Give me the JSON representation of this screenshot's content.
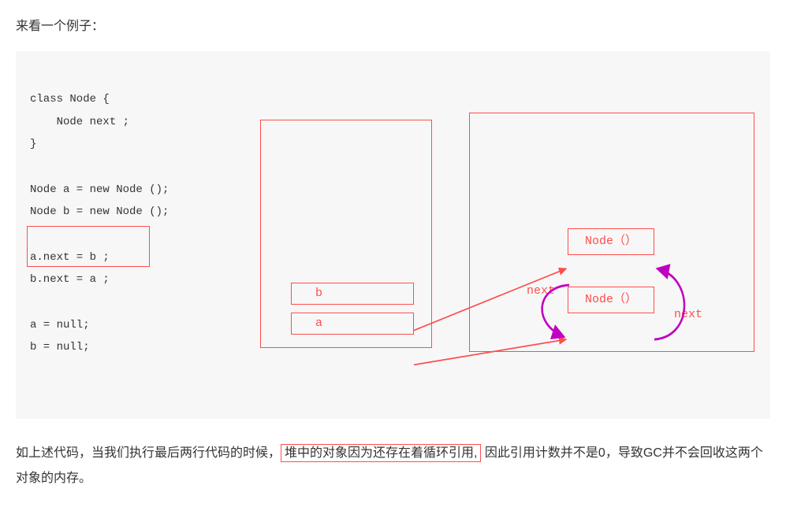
{
  "intro": "来看一个例子：",
  "code": {
    "l1": "class Node {",
    "l2": "    Node next ;",
    "l3": "}",
    "l4": "",
    "l5": "Node a = new Node ();",
    "l6": "Node b = new Node ();",
    "l7": "",
    "l8": "a.next = b ;",
    "l9": "b.next = a ;",
    "l10": "",
    "l11": "a = null;",
    "l12": "b = null;"
  },
  "diagram": {
    "stack_b": "b",
    "stack_a": "a",
    "node1": "Node（）",
    "node2": "Node（）",
    "label_next_left": "next",
    "label_next_right": "next"
  },
  "conclusion": {
    "part1": "如上述代码，当我们执行最后两行代码的时候，",
    "highlight": "堆中的对象因为还存在着循环引用,",
    "part2": " 因此引用计数并不是0，导致GC并不会回收这两个对象的内存。"
  }
}
